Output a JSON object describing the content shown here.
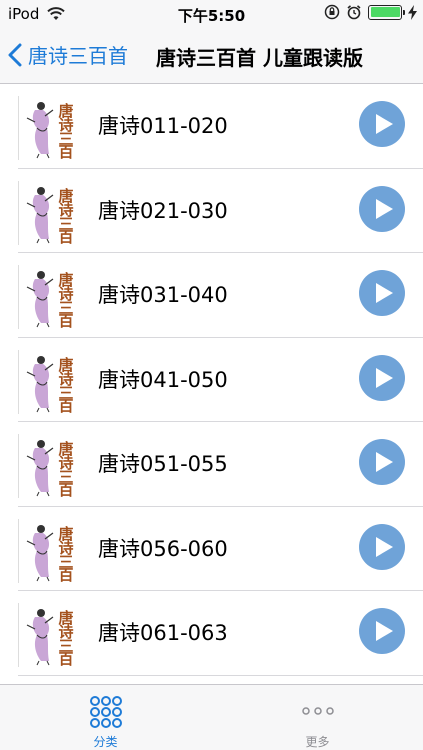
{
  "status_bar": {
    "carrier": "iPod",
    "time": "下午5:50",
    "battery_level": 1.0,
    "icons": [
      "wifi-icon",
      "orientation-lock-icon",
      "alarm-icon",
      "battery-icon",
      "charging-icon"
    ]
  },
  "nav": {
    "back_label": "唐诗三百首",
    "title": "唐诗三百首 儿童跟读版"
  },
  "list": {
    "items": [
      {
        "label": "唐诗011-020"
      },
      {
        "label": "唐诗021-030"
      },
      {
        "label": "唐诗031-040"
      },
      {
        "label": "唐诗041-050"
      },
      {
        "label": "唐诗051-055"
      },
      {
        "label": "唐诗056-060"
      },
      {
        "label": "唐诗061-063"
      }
    ],
    "thumbnail_text": "唐诗三百首"
  },
  "tab_bar": {
    "tabs": [
      {
        "label": "分类",
        "icon": "grid-icon",
        "active": true
      },
      {
        "label": "更多",
        "icon": "more-icon",
        "active": false
      }
    ]
  },
  "colors": {
    "accent": "#1e7bd7",
    "play_button": "#6fa3d8",
    "battery": "#4cd964"
  }
}
